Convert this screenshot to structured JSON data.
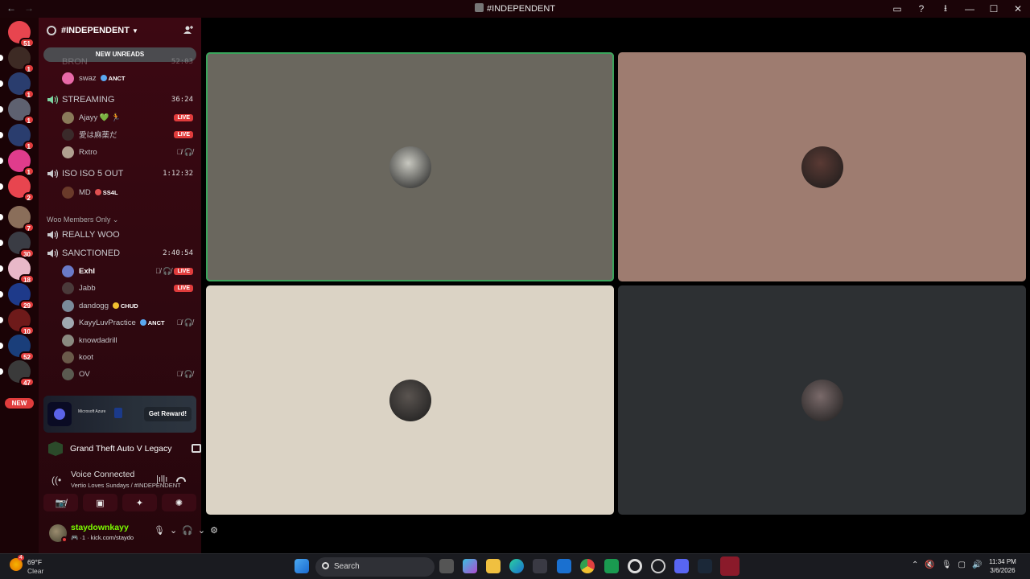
{
  "titlebar": {
    "back": "←",
    "forward": "→",
    "title": "#INDEPENDENT",
    "buttons": [
      "▭",
      "?",
      "⭳",
      "—",
      "☐",
      "✕"
    ]
  },
  "server_rail": {
    "servers": [
      {
        "name": "discord-home",
        "badge": "51",
        "color": "#e8454f",
        "pill": false
      },
      {
        "name": "server-2",
        "badge": "1",
        "color": "#3d2a24",
        "pill": true
      },
      {
        "name": "server-3",
        "badge": "1",
        "color": "#2a3d6e",
        "pill": true
      },
      {
        "name": "server-4",
        "badge": "1",
        "color": "#5e6170",
        "pill": true
      },
      {
        "name": "server-5",
        "badge": "1",
        "color": "#2a3d6e",
        "pill": true
      },
      {
        "name": "server-6",
        "badge": "1",
        "color": "#e03c8c",
        "pill": true
      },
      {
        "name": "server-7",
        "badge": "2",
        "color": "#e8454f",
        "pill": true
      },
      {
        "name": "server-8",
        "badge": "7",
        "color": "#8a6e5a",
        "pill": true
      },
      {
        "name": "server-9",
        "badge": "30",
        "color": "#3a3c44",
        "pill": true
      },
      {
        "name": "server-10",
        "badge": "18",
        "color": "#e8b8c8",
        "pill": true
      },
      {
        "name": "server-11",
        "badge": "29",
        "color": "#1e3a8a",
        "pill": true
      },
      {
        "name": "server-12",
        "badge": "10",
        "color": "#6e1a1a",
        "pill": true
      },
      {
        "name": "server-13",
        "badge": "52",
        "color": "#1a3e7a",
        "pill": true
      },
      {
        "name": "server-14",
        "badge": "47",
        "color": "#3a3a3a",
        "pill": true
      }
    ],
    "new_label": "NEW"
  },
  "sidebar": {
    "server_name": "#INDEPENDENT",
    "new_unreads": "NEW UNREADS",
    "channels": [
      {
        "name": "BRON",
        "timer": "52:03"
      },
      {
        "name": "STREAMING",
        "timer": "36:24"
      },
      {
        "name": "ISO ISO 5 OUT",
        "timer": "1:12:32"
      },
      {
        "name": "REALLY WOO",
        "timer": ""
      },
      {
        "name": "SANCTIONED",
        "timer": "2:40:54"
      }
    ],
    "category": "Woo Members Only",
    "users": {
      "swaz": {
        "name": "swaz",
        "tag": "ANCT"
      },
      "ajayy": {
        "name": "Ajayy 💚 🏃",
        "live": "LIVE"
      },
      "u2": {
        "name": "愛は麻薬だ",
        "live": "LIVE"
      },
      "rxtro": {
        "name": "Rxtro",
        "mute": "🎙̸ 🎧̸"
      },
      "md": {
        "name": "MD",
        "tag": "SS4L"
      },
      "exhl": {
        "name": "Exhl",
        "mute": "🎙̸ 🎧̸",
        "live": "LIVE"
      },
      "jabb": {
        "name": "Jabb",
        "live": "LIVE"
      },
      "dandogg": {
        "name": "dandogg",
        "tag": "CHUD"
      },
      "kayy": {
        "name": "KayyLuvPractice",
        "tag": "ANCT",
        "mute": "🎙̸ 🎧̸"
      },
      "knowdadrill": {
        "name": "knowdadrill"
      },
      "koot": {
        "name": "koot"
      },
      "ov": {
        "name": "OV",
        "mute": "🎙̸ 🎧̸"
      }
    },
    "promo": {
      "brand": "Microsoft Azure",
      "button": "Get Reward!"
    },
    "game": "Grand Theft Auto V Legacy",
    "voice": {
      "status": "Voice Connected",
      "location": "Vertio Loves Sundays / #INDEPENDENT"
    },
    "controls": [
      "📷̸",
      "▣",
      "✦",
      "✺"
    ],
    "user": {
      "name": "staydownkayy",
      "status": "🎮 ·1 · kick.com/staydo",
      "icons": [
        "🎙",
        "⌄",
        "🎧",
        "⌄",
        "⚙"
      ]
    }
  },
  "video_tiles": [
    {
      "name": "tile-1",
      "bg": "#6a675e",
      "face": "#c8c8c0",
      "speaking": true
    },
    {
      "name": "tile-2",
      "bg": "#9e7c70",
      "face": "#5a3a34",
      "speaking": false
    },
    {
      "name": "tile-3",
      "bg": "#dbd3c5",
      "face": "#5a5450",
      "speaking": false
    },
    {
      "name": "tile-4",
      "bg": "#2d3033",
      "face": "#7a6a6a",
      "speaking": false
    }
  ],
  "taskbar": {
    "weather_temp": "69°F",
    "weather_cond": "Clear",
    "weather_badge": "4",
    "search": "Search",
    "tray_icons": [
      "⌃",
      "🔇",
      "🎙",
      "▢",
      "🔊"
    ],
    "time": "11:34 PM",
    "date": "3/6/2026"
  }
}
